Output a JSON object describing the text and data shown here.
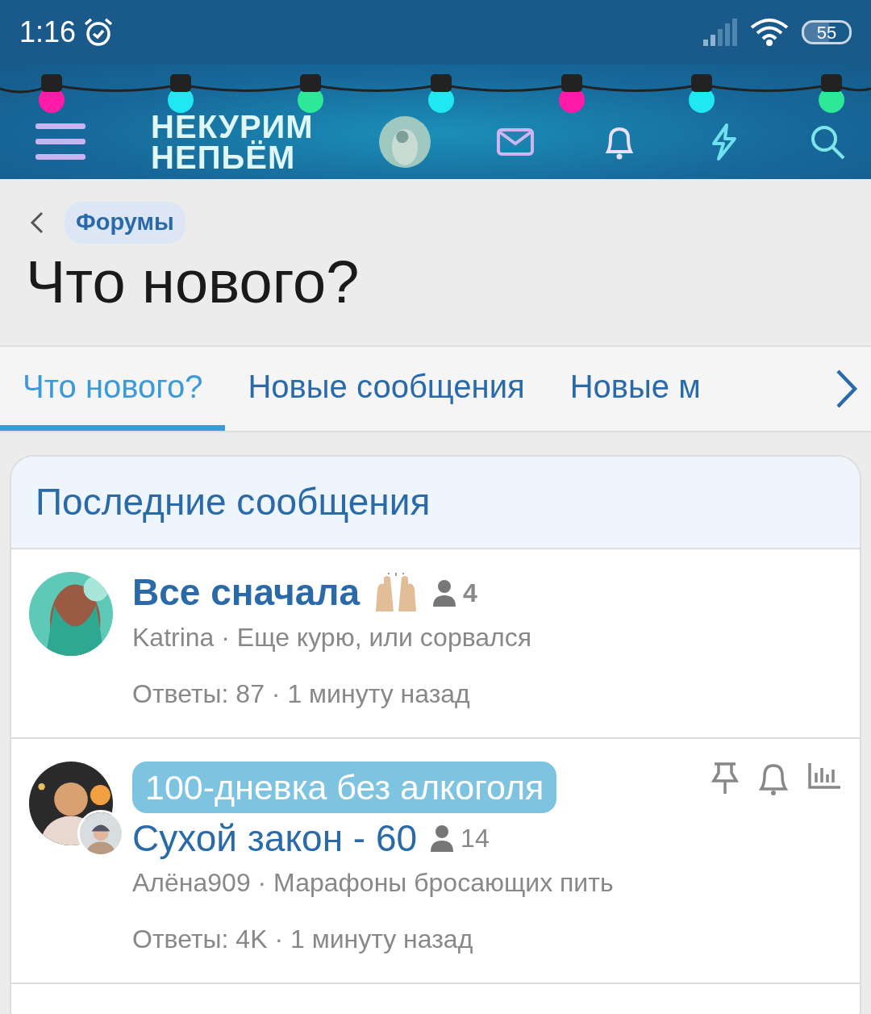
{
  "status_bar": {
    "time": "1:16",
    "battery": "55"
  },
  "header": {
    "logo_lines": [
      "НЕКУРИМ",
      "НЕПЬЁМ"
    ]
  },
  "breadcrumb": {
    "label": "Форумы"
  },
  "page_title": "Что нового?",
  "tabs": [
    {
      "label": "Что нового?",
      "selected": true
    },
    {
      "label": "Новые сообщения",
      "selected": false
    },
    {
      "label": "Новые м",
      "selected": false
    }
  ],
  "section": {
    "title": "Последние сообщения",
    "threads": [
      {
        "title": "Все сначала",
        "unread": true,
        "emoji": true,
        "participants": "4",
        "meta": "Katrina · Еще курю, или сорвался",
        "stats": "Ответы: 87 · 1 минуту назад",
        "second_avatar": false,
        "watched": false
      },
      {
        "prefix": "100-дневка без алкоголя",
        "title": "Сухой закон - 60",
        "unread": false,
        "emoji": false,
        "participants": "14",
        "meta": "Алёна909 · Марафоны бросающих пить",
        "stats": "Ответы: 4K · 1 минуту назад",
        "second_avatar": true,
        "watched": true
      }
    ]
  }
}
